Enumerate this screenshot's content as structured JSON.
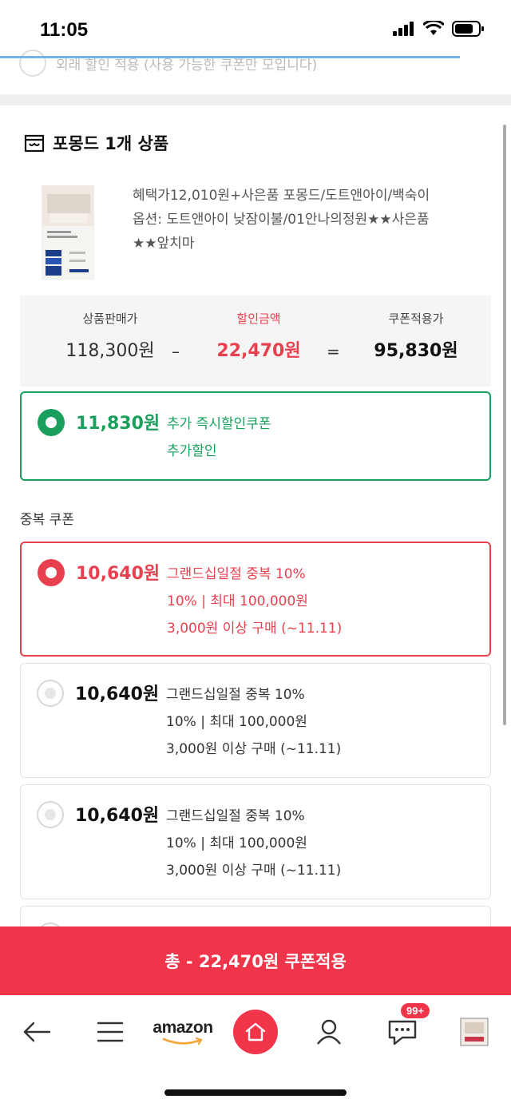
{
  "status_bar": {
    "time": "11:05"
  },
  "faded_top_row": {
    "text": "외래 할인 적용 (사용 가능한 쿠폰만 모입니다)"
  },
  "section": {
    "title": "포몽드 1개 상품"
  },
  "product": {
    "name_line1": "혜택가12,010원+사은품 포몽드/도트앤아이/백숙이",
    "option_line1": "옵션: 도트앤아이 낮잠이불/01안나의정원★★사은품",
    "option_line2": "★★앞치마"
  },
  "price_summary": {
    "sale_price_label": "상품판매가",
    "sale_price": "118,300원",
    "minus": "–",
    "discount_label": "할인금액",
    "discount": "22,470원",
    "equals": "=",
    "coupon_price_label": "쿠폰적용가",
    "coupon_price": "95,830원"
  },
  "instant_coupon": {
    "amount": "11,830원",
    "line1": "추가 즉시할인쿠폰",
    "line2": "추가할인",
    "selected": true
  },
  "duplicate_section": {
    "label": "중복 쿠폰"
  },
  "duplicate_coupons": [
    {
      "amount": "10,640원",
      "line1": "그랜드십일절 중복 10%",
      "line2": "10% | 최대 100,000원",
      "line3": "3,000원 이상 구매 (~11.11)",
      "selected": true
    },
    {
      "amount": "10,640원",
      "line1": "그랜드십일절 중복 10%",
      "line2": "10% | 최대 100,000원",
      "line3": "3,000원 이상 구매 (~11.11)",
      "selected": false
    },
    {
      "amount": "10,640원",
      "line1": "그랜드십일절 중복 10%",
      "line2": "10% | 최대 100,000원",
      "line3": "3,000원 이상 구매 (~11.11)",
      "selected": false
    }
  ],
  "cta": {
    "label": "총 - 22,470원 쿠폰적용"
  },
  "bottom_nav": {
    "amazon_label": "amazon",
    "chat_badge": "99+",
    "icons": [
      "back-arrow-icon",
      "menu-icon",
      "amazon-logo",
      "home-icon",
      "user-icon",
      "chat-icon",
      "recent-item-thumbnail"
    ]
  },
  "colors": {
    "green": "#1a9f5c",
    "red": "#e8404e",
    "cta": "#f0344a"
  }
}
